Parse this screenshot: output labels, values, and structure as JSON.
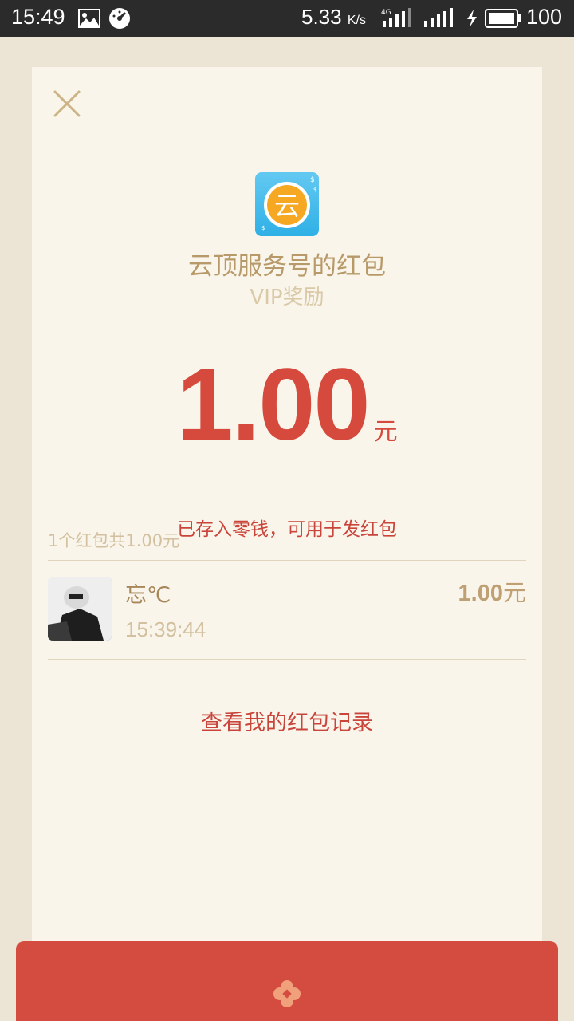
{
  "status_bar": {
    "time": "15:49",
    "net_speed": "5.33",
    "net_speed_unit": "K/s",
    "network_type": "4G",
    "battery_pct": "100"
  },
  "header": {
    "sender_title": "云顶服务号的红包",
    "subtitle": "VIP奖励"
  },
  "app_icon": {
    "glyph": "云",
    "color": "#2fb0e6",
    "coin_color": "#f7a823"
  },
  "amount": {
    "value": "1.00",
    "unit": "元",
    "note": "已存入零钱，可用于发红包"
  },
  "summary": "1个红包共1.00元",
  "receivers": [
    {
      "name": "忘℃",
      "time": "15:39:44",
      "amount": "1.00",
      "unit": "元"
    }
  ],
  "records_link": "查看我的红包记录",
  "colors": {
    "accent_red": "#d54a3d",
    "gold": "#b89a6a",
    "card_bg": "#faf5eb",
    "page_bg": "#ece4d4"
  }
}
